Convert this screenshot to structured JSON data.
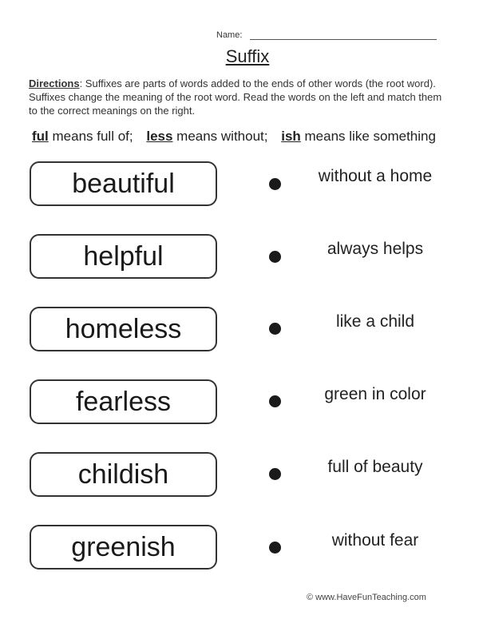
{
  "header": {
    "name_label": "Name:",
    "title": "Suffix"
  },
  "directions": {
    "label": "Directions",
    "text": ":  Suffixes are parts of words added to the ends of other words (the root word).  Suffixes change the meaning of the root word.  Read the words on the left and match them to the correct meanings on the right."
  },
  "suffix_key": [
    {
      "suffix": "ful",
      "meaning": " means full of;"
    },
    {
      "suffix": "less",
      "meaning": " means without;"
    },
    {
      "suffix": "ish",
      "meaning": " means like something"
    }
  ],
  "words": [
    "beautiful",
    "helpful",
    "homeless",
    "fearless",
    "childish",
    "greenish"
  ],
  "meanings": [
    "without a home",
    "always helps",
    "like a child",
    "green in color",
    "full of beauty",
    "without fear"
  ],
  "footer": "© www.HaveFunTeaching.com"
}
